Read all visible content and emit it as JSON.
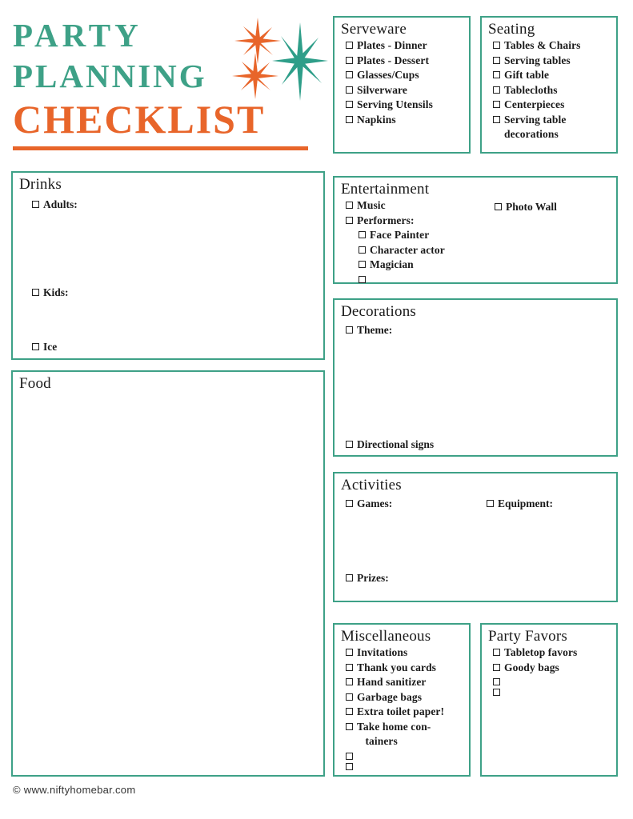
{
  "document": {
    "title_line1": "PARTY",
    "title_line2": "PLANNING",
    "title_line3": "CHECKLIST",
    "footer": "© www.niftyhomebar.com"
  },
  "colors": {
    "teal": "#3EA187",
    "orange": "#E8652A",
    "border": "#3EA187",
    "text": "#1a1a1a"
  },
  "sections": {
    "serveware": {
      "title": "Serveware",
      "items": [
        "Plates - Dinner",
        "Plates - Dessert",
        "Glasses/Cups",
        "Silverware",
        "Serving Utensils",
        "Napkins"
      ]
    },
    "seating": {
      "title": "Seating",
      "items": [
        "Tables & Chairs",
        "Serving tables",
        "Gift table",
        "Tablecloths",
        "Centerpieces",
        "Serving table\ndecorations"
      ]
    },
    "drinks": {
      "title": "Drinks",
      "items": [
        "Adults:",
        "Kids:",
        "Ice"
      ]
    },
    "food": {
      "title": "Food",
      "items": []
    },
    "entertainment": {
      "title": "Entertainment",
      "items": [
        "Music",
        "Performers:"
      ],
      "subitems": [
        "Face Painter",
        "Character actor",
        "Magician",
        ""
      ],
      "right_item": "Photo Wall"
    },
    "decorations": {
      "title": "Decorations",
      "items": [
        "Theme:",
        "Directional signs"
      ]
    },
    "activities": {
      "title": "Activities",
      "items": [
        "Games:",
        "Prizes:"
      ],
      "right_item": "Equipment:"
    },
    "miscellaneous": {
      "title": "Miscellaneous",
      "items": [
        "Invitations",
        "Thank you cards",
        "Hand sanitizer",
        "Garbage bags",
        "Extra toilet paper!",
        "Take home con-\n   tainers",
        "",
        ""
      ]
    },
    "party_favors": {
      "title": "Party Favors",
      "items": [
        "Tabletop favors",
        "Goody bags",
        "",
        ""
      ]
    }
  }
}
